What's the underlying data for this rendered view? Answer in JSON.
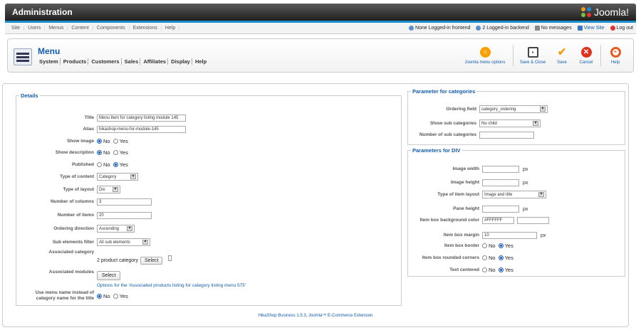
{
  "header": {
    "title": "Administration",
    "logo_text": "Joomla!"
  },
  "menubar": {
    "left": [
      "Site",
      "Users",
      "Menus",
      "Content",
      "Components",
      "Extensions",
      "Help"
    ],
    "right": [
      "None Logged-in frontend",
      "2 Logged-in backend",
      "No messages",
      "View Site",
      "Log out"
    ]
  },
  "toolbar": {
    "title": "Menu",
    "submenu": [
      "System",
      "Products",
      "Customers",
      "Sales",
      "Affiliates",
      "Display",
      "Help"
    ],
    "joomla_options": "Joomla menu options",
    "save_close": "Save & Close",
    "save": "Save",
    "cancel": "Cancel",
    "help": "Help"
  },
  "details": {
    "legend": "Details",
    "title_label": "Title",
    "title_value": "Menu item for category listing module 145",
    "alias_label": "Alias",
    "alias_value": "hikashop-menu-for-module-145",
    "show_image_label": "Show image",
    "show_description_label": "Show description",
    "published_label": "Published",
    "type_content_label": "Type of content",
    "type_content_value": "Category",
    "type_layout_label": "Type of layout",
    "type_layout_value": "Div",
    "num_columns_label": "Number of columns",
    "num_columns_value": "3",
    "num_items_label": "Number of items",
    "num_items_value": "20",
    "ordering_label": "Ordering direction",
    "ordering_value": "Ascending",
    "sub_filter_label": "Sub elements filter",
    "sub_filter_value": "All sub elements",
    "assoc_category_label": "Associated category",
    "assoc_category_value": "2 product category",
    "assoc_modules_label": "Associated modules",
    "select_label": "Select",
    "options_link": "Options for the 'Associated products listing for category listing menu 575'",
    "use_menu_name_label": "Use menu name instead of category name for the title",
    "no": "No",
    "yes": "Yes"
  },
  "categories": {
    "legend": "Parameter for categories",
    "ordering_label": "Ordering field",
    "ordering_value": "category_ordering",
    "show_sub_label": "Show sub categories",
    "show_sub_value": "No child",
    "num_sub_label": "Number of sub categories",
    "num_sub_value": ""
  },
  "div_params": {
    "legend": "Parameters for DIV",
    "image_width_label": "Image width",
    "image_height_label": "Image height",
    "item_layout_label": "Type of item layout",
    "item_layout_value": "Image and title",
    "pane_height_label": "Pane height",
    "bg_color_label": "Item box background color",
    "bg_color_value": "#FFFFFF",
    "margin_label": "Item box margin",
    "margin_value": "10",
    "border_label": "Item box border",
    "rounded_label": "Item box rounded corners",
    "text_centered_label": "Text centered",
    "px": "px"
  },
  "footer": {
    "text": "HikaShop Business 1.5.3, Joomla™ E-Commerce Extension"
  }
}
